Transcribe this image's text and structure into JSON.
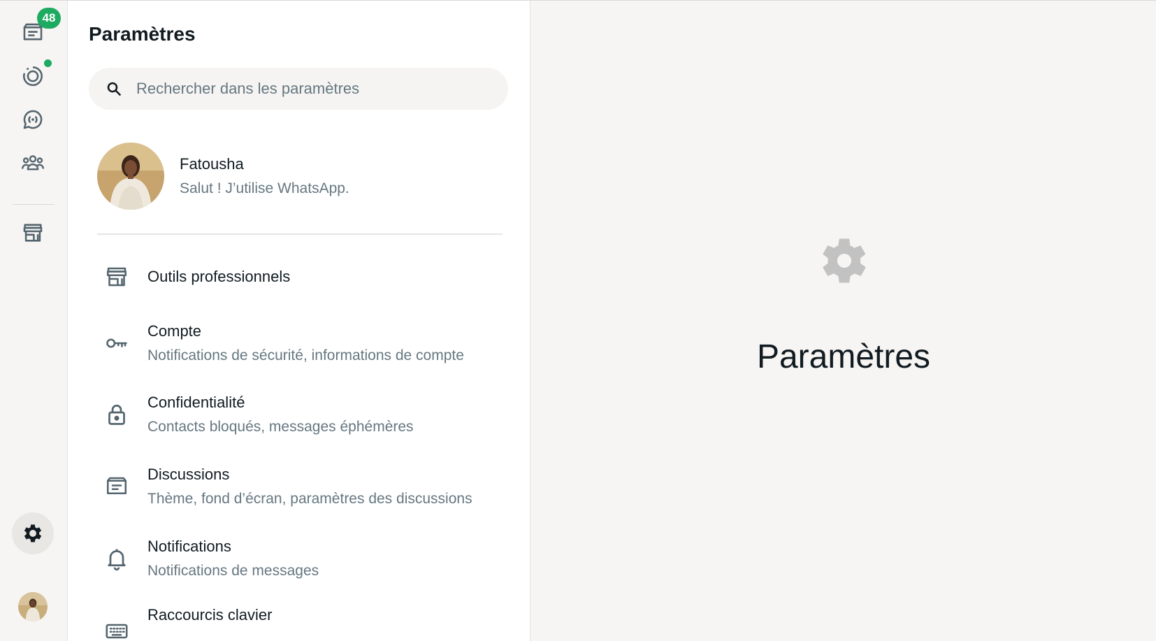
{
  "rail": {
    "chats_badge": "48",
    "items": [
      {
        "name": "chats",
        "icon": "chats-icon"
      },
      {
        "name": "status",
        "icon": "status-icon"
      },
      {
        "name": "channels",
        "icon": "channels-icon"
      },
      {
        "name": "communities",
        "icon": "communities-icon"
      },
      {
        "name": "business-tools",
        "icon": "storefront-icon"
      },
      {
        "name": "settings",
        "icon": "gear-icon",
        "active": true
      }
    ],
    "status_unread": true
  },
  "settings": {
    "title": "Paramètres",
    "search_placeholder": "Rechercher dans les paramètres",
    "profile": {
      "name": "Fatousha",
      "about": "Salut ! J’utilise WhatsApp."
    },
    "items": [
      {
        "title": "Outils professionnels",
        "subtitle": "",
        "icon": "storefront-icon"
      },
      {
        "title": "Compte",
        "subtitle": "Notifications de sécurité, informations de compte",
        "icon": "key-icon"
      },
      {
        "title": "Confidentialité",
        "subtitle": "Contacts bloqués, messages éphémères",
        "icon": "lock-icon"
      },
      {
        "title": "Discussions",
        "subtitle": "Thème, fond d’écran, paramètres des discussions",
        "icon": "chat-icon"
      },
      {
        "title": "Notifications",
        "subtitle": "Notifications de messages",
        "icon": "bell-icon"
      },
      {
        "title": "Raccourcis clavier",
        "subtitle": "",
        "icon": "keyboard-icon"
      }
    ]
  },
  "main": {
    "title": "Paramètres",
    "icon": "gear-icon"
  },
  "colors": {
    "accent": "#1daa61",
    "background": "#f7f5f3",
    "panel": "#ffffff",
    "muted_text": "#667781"
  }
}
